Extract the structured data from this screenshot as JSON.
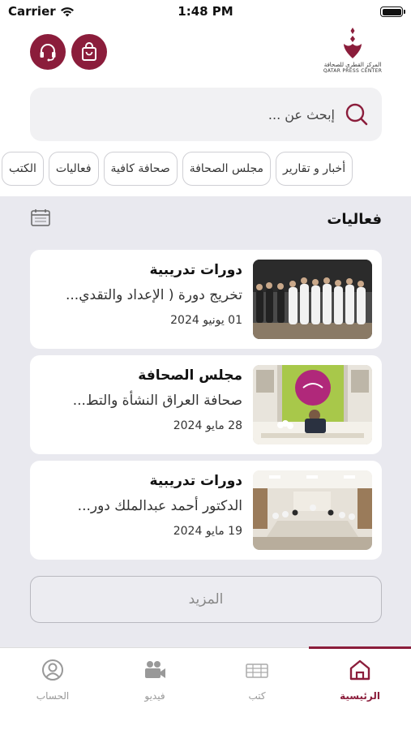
{
  "status": {
    "carrier": "Carrier",
    "time": "1:48 PM"
  },
  "header": {
    "logo_text_ar": "المركز القطري للصحافة",
    "logo_text_en": "QATAR PRESS CENTER"
  },
  "search": {
    "placeholder": "إبحث عن ..."
  },
  "chips": [
    "أخبار و تقارير",
    "مجلس الصحافة",
    "صحافة كافية",
    "فعاليات",
    "الكتب"
  ],
  "section": {
    "title": "فعاليات"
  },
  "cards": [
    {
      "category": "دورات تدريبية",
      "title": "تخريج دورة ( الإعداد والتقدي...",
      "date": "01 يونيو 2024"
    },
    {
      "category": "مجلس الصحافة",
      "title": "صحافة العراق النشأة والتط...",
      "date": "28 مايو 2024"
    },
    {
      "category": "دورات تدريبية",
      "title": "الدكتور أحمد عبدالملك دور...",
      "date": "19 مايو 2024"
    }
  ],
  "more_button": "المزيد",
  "tabs": [
    {
      "label": "الرئيسية",
      "icon": "home-icon",
      "active": true
    },
    {
      "label": "كتب",
      "icon": "books-icon",
      "active": false
    },
    {
      "label": "فيديو",
      "icon": "video-camera-icon",
      "active": false
    },
    {
      "label": "الحساب",
      "icon": "account-icon",
      "active": false
    }
  ],
  "colors": {
    "brand": "#8b1d3b",
    "section_bg": "#e9e9ef"
  }
}
